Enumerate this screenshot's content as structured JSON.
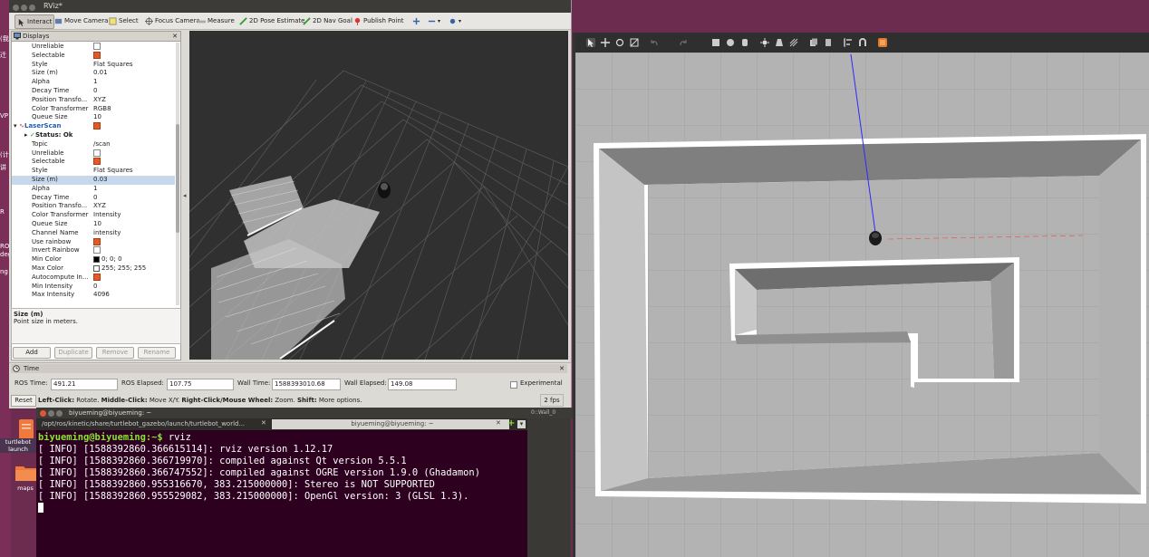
{
  "desktop": {
    "fragments": [
      "(我",
      "迁",
      "VP",
      "(计",
      "讲",
      "R",
      "ROS",
      "deg",
      "ng"
    ],
    "icons": [
      {
        "name": "turtlebot_launch",
        "label1": "turtlebot",
        "label2": "launch"
      },
      {
        "name": "maps",
        "label1": "maps"
      }
    ]
  },
  "rviz": {
    "window_title": "RViz*",
    "toolbar": {
      "interact": "Interact",
      "move_camera": "Move Camera",
      "select": "Select",
      "focus_camera": "Focus Camera",
      "measure": "Measure",
      "pose_estimate": "2D Pose Estimate",
      "nav_goal": "2D Nav Goal",
      "publish_point": "Publish Point"
    },
    "displays_title": "Displays",
    "properties": [
      {
        "k": "Unreliable",
        "v": "",
        "cb": "off"
      },
      {
        "k": "Selectable",
        "v": "",
        "cb": "on"
      },
      {
        "k": "Style",
        "v": "Flat Squares"
      },
      {
        "k": "Size (m)",
        "v": "0.01"
      },
      {
        "k": "Alpha",
        "v": "1"
      },
      {
        "k": "Decay Time",
        "v": "0"
      },
      {
        "k": "Position Transfo...",
        "v": "XYZ"
      },
      {
        "k": "Color Transformer",
        "v": "RGB8"
      },
      {
        "k": "Queue Size",
        "v": "10"
      },
      {
        "k": "LaserScan",
        "v": "",
        "cb": "on",
        "header": true
      },
      {
        "k": "Status: Ok",
        "v": "",
        "status": true
      },
      {
        "k": "Topic",
        "v": "/scan"
      },
      {
        "k": "Unreliable",
        "v": "",
        "cb": "off"
      },
      {
        "k": "Selectable",
        "v": "",
        "cb": "on"
      },
      {
        "k": "Style",
        "v": "Flat Squares"
      },
      {
        "k": "Size (m)",
        "v": "0.03",
        "selected": true
      },
      {
        "k": "Alpha",
        "v": "1"
      },
      {
        "k": "Decay Time",
        "v": "0"
      },
      {
        "k": "Position Transfo...",
        "v": "XYZ"
      },
      {
        "k": "Color Transformer",
        "v": "Intensity"
      },
      {
        "k": "Queue Size",
        "v": "10"
      },
      {
        "k": "Channel Name",
        "v": "intensity"
      },
      {
        "k": "Use rainbow",
        "v": "",
        "cb": "on"
      },
      {
        "k": "Invert Rainbow",
        "v": "",
        "cb": "off"
      },
      {
        "k": "Min Color",
        "v": "0; 0; 0",
        "swatch": "#000000"
      },
      {
        "k": "Max Color",
        "v": "255; 255; 255",
        "swatch": "#ffffff"
      },
      {
        "k": "Autocompute In...",
        "v": "",
        "cb": "on"
      },
      {
        "k": "Min Intensity",
        "v": "0"
      },
      {
        "k": "Max Intensity",
        "v": "4096"
      }
    ],
    "description": {
      "title": "Size (m)",
      "text": "Point size in meters."
    },
    "panel_buttons": {
      "add": "Add",
      "duplicate": "Duplicate",
      "remove": "Remove",
      "rename": "Rename"
    },
    "time": {
      "title": "Time",
      "ros_time_label": "ROS Time:",
      "ros_time": "491.21",
      "ros_elapsed_label": "ROS Elapsed:",
      "ros_elapsed": "107.75",
      "wall_time_label": "Wall Time:",
      "wall_time": "1588393010.68",
      "wall_elapsed_label": "Wall Elapsed:",
      "wall_elapsed": "149.08",
      "experimental": "Experimental",
      "reset": "Reset",
      "hint_left_click": "Left-Click:",
      "hint_left_click_action": " Rotate. ",
      "hint_middle_click": "Middle-Click:",
      "hint_middle_click_action": " Move X/Y. ",
      "hint_right_click": "Right-Click/Mouse Wheel:",
      "hint_right_click_action": " Zoom. ",
      "hint_shift": "Shift:",
      "hint_shift_action": " More options.",
      "fps": "2 fps"
    }
  },
  "terminal": {
    "window_title": "biyueming@biyueming: ~",
    "tabs": [
      "/opt/ros/kinetic/share/turtlebot_gazebo/launch/turtlebot_world...",
      "biyueming@biyueming: ~"
    ],
    "prompt": "biyueming@biyueming:~$",
    "command": " rviz",
    "lines": [
      "[ INFO] [1588392860.366615114]: rviz version 1.12.17",
      "[ INFO] [1588392860.366719970]: compiled against Qt version 5.5.1",
      "[ INFO] [1588392860.366747552]: compiled against OGRE version 1.9.0 (Ghadamon)",
      "[ INFO] [1588392860.955316670, 383.215000000]: Stereo is NOT SUPPORTED",
      "[ INFO] [1588392860.955529082, 383.215000000]: OpenGl version: 3 (GLSL 1.3)."
    ]
  },
  "gazebo_strip": {
    "label": "0::Wall_0"
  }
}
